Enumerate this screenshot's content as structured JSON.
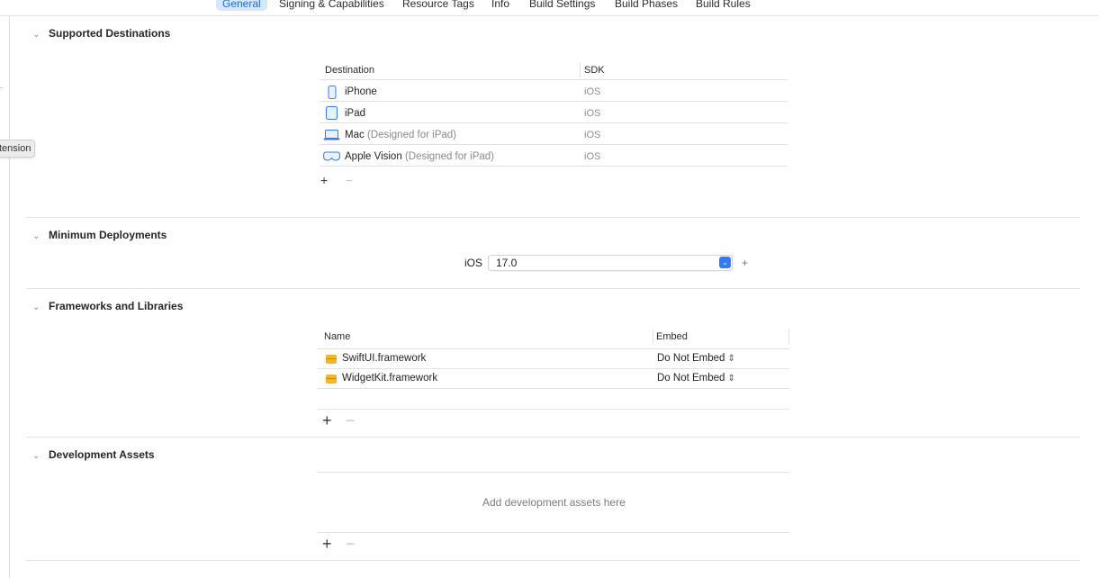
{
  "tabs": [
    {
      "label": "General",
      "active": true
    },
    {
      "label": "Signing & Capabilities",
      "active": false
    },
    {
      "label": "Resource Tags",
      "active": false
    },
    {
      "label": "Info",
      "active": false
    },
    {
      "label": "Build Settings",
      "active": false
    },
    {
      "label": "Build Phases",
      "active": false
    },
    {
      "label": "Build Rules",
      "active": false
    }
  ],
  "tooltip": "tension",
  "supported_destinations": {
    "title": "Supported Destinations",
    "col_destination": "Destination",
    "col_sdk": "SDK",
    "rows": [
      {
        "icon": "iphone-icon",
        "name": "iPhone",
        "note": "",
        "sdk": "iOS"
      },
      {
        "icon": "ipad-icon",
        "name": "iPad",
        "note": "",
        "sdk": "iOS"
      },
      {
        "icon": "mac-icon",
        "name": "Mac",
        "note": "(Designed for iPad)",
        "sdk": "iOS"
      },
      {
        "icon": "vision-icon",
        "name": "Apple Vision",
        "note": "(Designed for iPad)",
        "sdk": "iOS"
      }
    ],
    "add_label": "+",
    "remove_label": "−"
  },
  "minimum_deployments": {
    "title": "Minimum Deployments",
    "platform": "iOS",
    "version": "17.0",
    "add_label": "+"
  },
  "frameworks": {
    "title": "Frameworks and Libraries",
    "col_name": "Name",
    "col_embed": "Embed",
    "rows": [
      {
        "name": "SwiftUI.framework",
        "embed": "Do Not Embed"
      },
      {
        "name": "WidgetKit.framework",
        "embed": "Do Not Embed"
      }
    ],
    "add_label": "+",
    "remove_label": "−"
  },
  "development_assets": {
    "title": "Development Assets",
    "empty_message": "Add development assets here",
    "add_label": "+",
    "remove_label": "−"
  },
  "colors": {
    "accent": "#2f7cf6",
    "tab_active_bg": "#d6e6fb",
    "framework_icon": "#f7b424"
  }
}
